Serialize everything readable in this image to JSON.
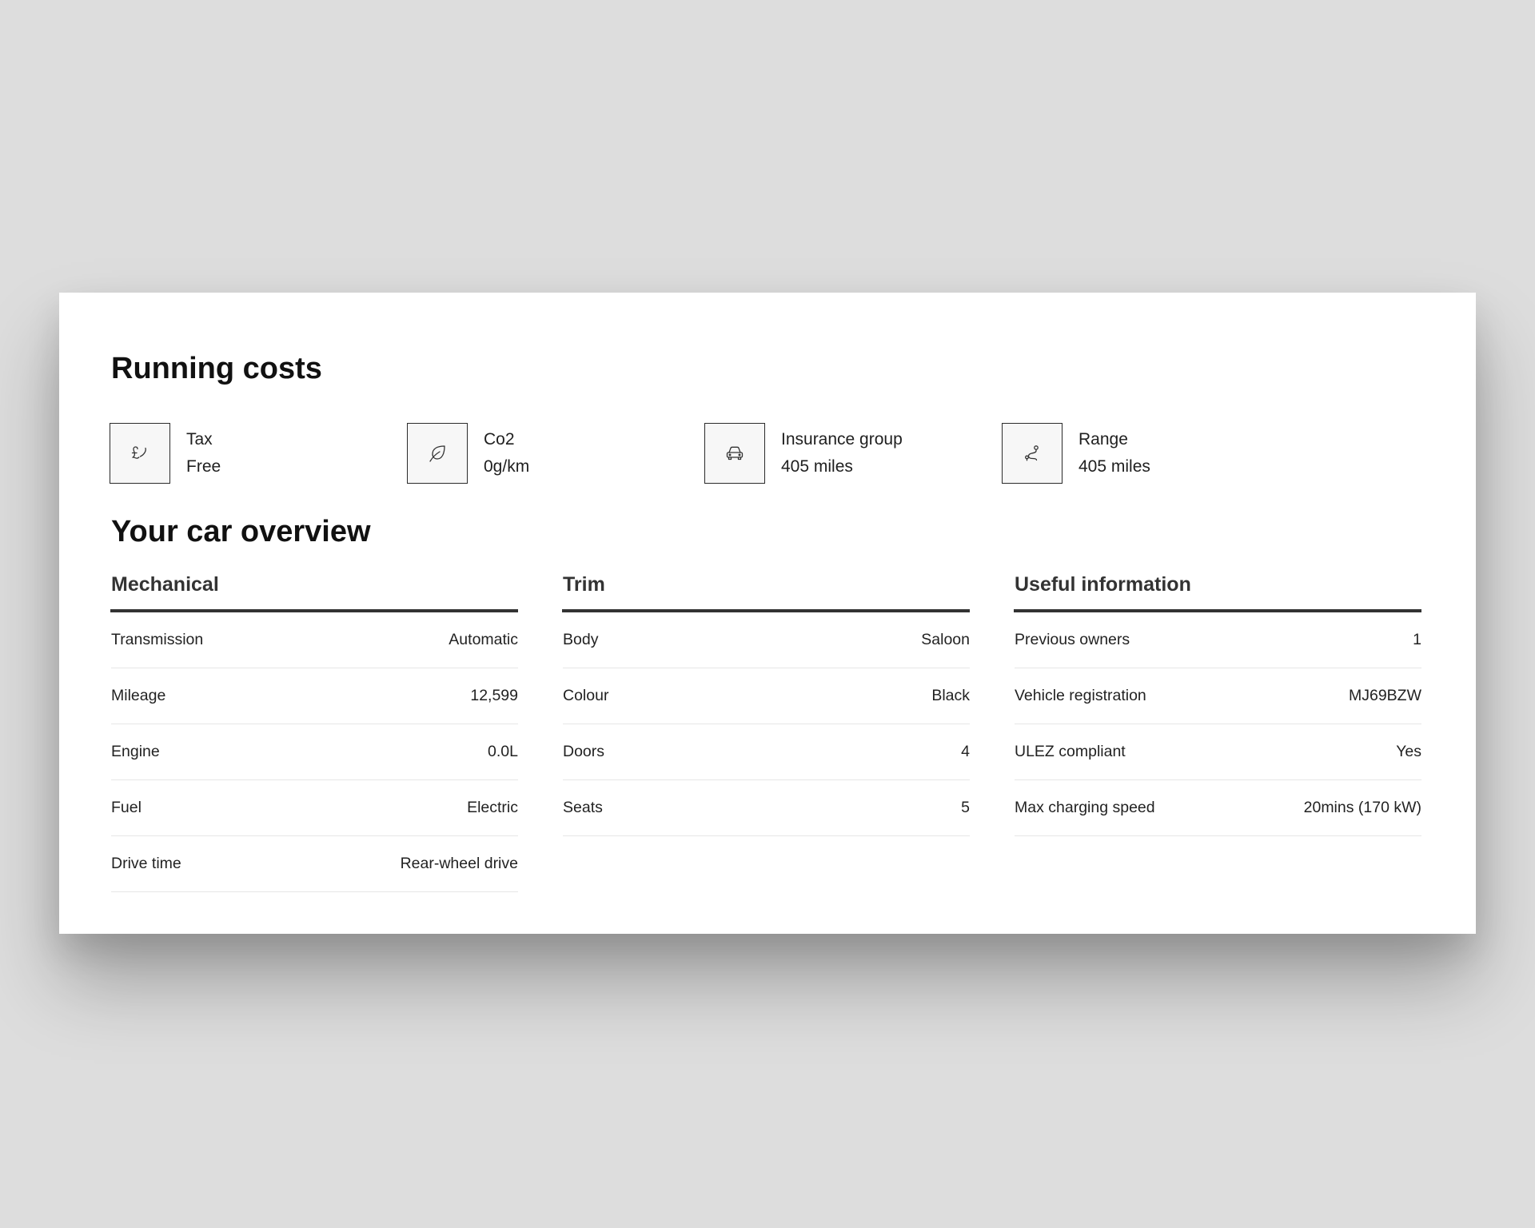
{
  "running_costs": {
    "title": "Running costs",
    "items": [
      {
        "icon": "pound-tax-icon",
        "label": "Tax",
        "value": "Free"
      },
      {
        "icon": "leaf-icon",
        "label": "Co2",
        "value": "0g/km"
      },
      {
        "icon": "car-icon",
        "label": "Insurance group",
        "value": "405 miles"
      },
      {
        "icon": "route-icon",
        "label": "Range",
        "value": "405 miles"
      }
    ]
  },
  "overview": {
    "title": "Your car overview",
    "columns": [
      {
        "header": "Mechanical",
        "rows": [
          {
            "label": "Transmission",
            "value": "Automatic"
          },
          {
            "label": "Mileage",
            "value": "12,599"
          },
          {
            "label": "Engine",
            "value": "0.0L"
          },
          {
            "label": "Fuel",
            "value": "Electric"
          },
          {
            "label": "Drive time",
            "value": "Rear-wheel drive"
          }
        ]
      },
      {
        "header": "Trim",
        "rows": [
          {
            "label": "Body",
            "value": "Saloon"
          },
          {
            "label": "Colour",
            "value": "Black"
          },
          {
            "label": "Doors",
            "value": "4"
          },
          {
            "label": "Seats",
            "value": "5"
          }
        ]
      },
      {
        "header": "Useful information",
        "rows": [
          {
            "label": "Previous owners",
            "value": "1"
          },
          {
            "label": "Vehicle registration",
            "value": "MJ69BZW"
          },
          {
            "label": "ULEZ compliant",
            "value": "Yes"
          },
          {
            "label": "Max charging speed",
            "value": "20mins (170 kW)"
          }
        ]
      }
    ]
  },
  "colors": {
    "page_background": "#dddddd",
    "card_background": "#ffffff",
    "heading": "#111111",
    "column_rule": "#333333",
    "row_divider": "#e6e6e6"
  }
}
